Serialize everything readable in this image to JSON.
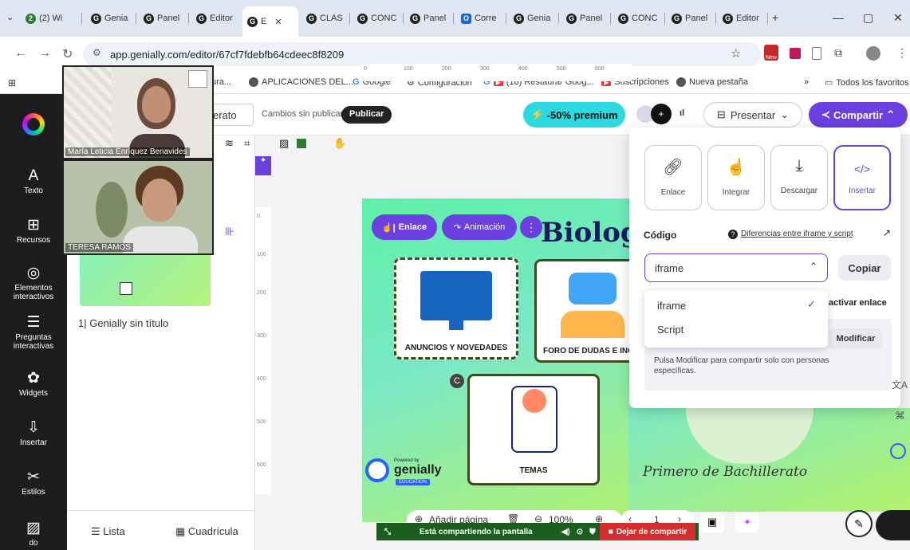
{
  "browser": {
    "tabs": [
      {
        "label": "(2) Wi",
        "badge": "2"
      },
      {
        "label": "Genia"
      },
      {
        "label": "Panel"
      },
      {
        "label": "Editor"
      },
      {
        "label": "E",
        "active": true
      },
      {
        "label": "CLAS"
      },
      {
        "label": "CONC"
      },
      {
        "label": "Panel"
      },
      {
        "label": "Corre"
      },
      {
        "label": "Genia"
      },
      {
        "label": "Panel"
      },
      {
        "label": "CONC"
      },
      {
        "label": "Panel"
      },
      {
        "label": "Editor"
      }
    ],
    "new_tab": "+",
    "window": {
      "minimize": "—",
      "restore": "▢",
      "close": "✕"
    },
    "url": "app.genially.com/editor/67cf7fdebfb64cdeec8f8209",
    "bookmarks": [
      {
        "label": "tura..."
      },
      {
        "label": "APLICACIONES DEL..."
      },
      {
        "label": "Google"
      },
      {
        "label": "Configuración"
      },
      {
        "label": "(18) Restaurar Goog..."
      },
      {
        "label": "Suscripciones"
      },
      {
        "label": "Nueva pestaña"
      }
    ],
    "bookmarks_more": "»",
    "all_bookmarks": "Todos los favoritos"
  },
  "editor": {
    "title_fragment": "erato",
    "unpublished": "Cambios sin publicar",
    "publish": "Publicar",
    "premium": "-50% premium",
    "present": "Presentar",
    "share": "Compartir"
  },
  "nav": [
    {
      "label": "Texto",
      "icon": "A"
    },
    {
      "label": "Recursos",
      "icon": "⊞"
    },
    {
      "label": "Elementos interactivos",
      "icon": "◎"
    },
    {
      "label": "Preguntas interactivas",
      "icon": "☰"
    },
    {
      "label": "Widgets",
      "icon": "✿"
    },
    {
      "label": "Insertar",
      "icon": "⇩"
    },
    {
      "label": "Estilos",
      "icon": "✂"
    },
    {
      "label": "do",
      "icon": "▨"
    }
  ],
  "pages": {
    "label": "1| Genially sin título",
    "list": "Lista",
    "grid": "Cuadrícula"
  },
  "ruler": [
    "0",
    "100",
    "200",
    "300",
    "400",
    "500",
    "600"
  ],
  "vruler": [
    "0",
    "100",
    "200",
    "300",
    "400",
    "500",
    "600"
  ],
  "slide": {
    "link_pill": "Enlace",
    "anim_pill": "Animación",
    "title": "Biolog",
    "card1": "ANUNCIOS Y NOVEDADES",
    "card2": "FORO DE DUDAS E  INQ",
    "card3": "TEMAS",
    "powered": "Powered by",
    "brand": "genially",
    "brand_sub": "EDUCATION",
    "subtitle": "Primero de Bachillerato"
  },
  "share_panel": {
    "options": [
      {
        "label": "Enlace",
        "icon": "link-icon"
      },
      {
        "label": "Integrar",
        "icon": "hand-icon"
      },
      {
        "label": "Descargar",
        "icon": "download-icon"
      },
      {
        "label": "Insertar",
        "icon": "code-icon",
        "selected": true
      }
    ],
    "code_label": "Código",
    "diff_link": "Diferencias entre iframe y script",
    "select_value": "iframe",
    "copy": "Copiar",
    "dropdown": [
      "iframe",
      "Script"
    ],
    "activate": "activar enlace",
    "modify": "Modificar",
    "info": "Pulsa Modificar para compartir solo con personas específicas."
  },
  "webcams": [
    {
      "name": "María Leticia Enríquez Benavides"
    },
    {
      "name": "TERESA RAMOS"
    }
  ],
  "bottom": {
    "add_page": "Añadir página",
    "zoom": "100%",
    "page": "1",
    "sharing": "Está compartiendo la pantalla",
    "stop": "Dejar de compartir"
  },
  "colors": {
    "accent": "#6b3fe0",
    "premium": "#2bd9e0",
    "nav_bg": "#1d1d1f",
    "share_bar": "#1b5e20"
  }
}
